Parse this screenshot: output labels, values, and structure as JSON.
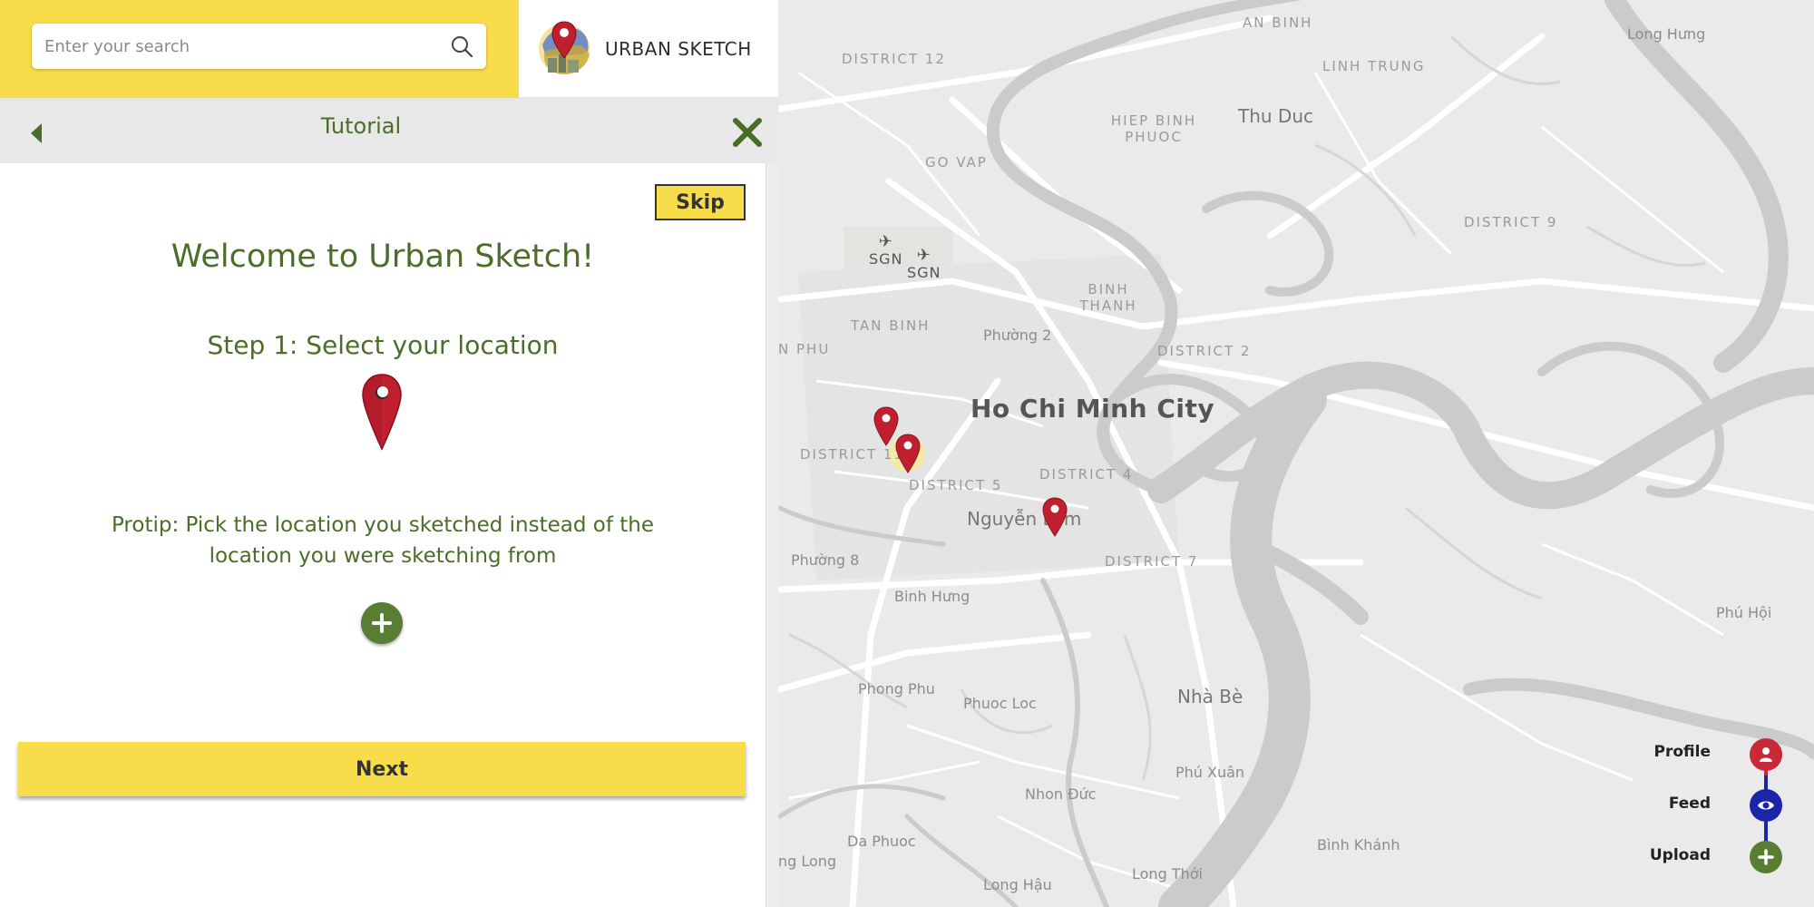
{
  "search": {
    "placeholder": "Enter your search"
  },
  "brand": {
    "name": "URBAN SKETCH"
  },
  "tutorial": {
    "title": "Tutorial",
    "skip_label": "Skip",
    "welcome": "Welcome to Urban Sketch!",
    "step": "Step 1: Select your location",
    "protip": "Protip: Pick the location you sketched instead of the location you were sketching from",
    "next_label": "Next"
  },
  "map": {
    "city": "Ho Chi Minh City",
    "labels": [
      "DISTRICT 12",
      "AN BINH",
      "LINH TRUNG",
      "Long Hưng",
      "HIEP BINH PHUOC",
      "Thu Duc",
      "GO VAP",
      "DISTRICT 9",
      "SGN",
      "BINH THANH",
      "TAN BINH",
      "Phường 2",
      "DISTRICT 2",
      "N PHU",
      "DISTRICT 11",
      "DISTRICT 5",
      "DISTRICT 4",
      "Nguyễn Lâm",
      "Phường 8",
      "DISTRICT 7",
      "Binh Hưng",
      "Phú Hội",
      "Phong Phu",
      "Phuoc Loc",
      "Nhà Bè",
      "Phú Xuân",
      "Nhon Đức",
      "Da Phuoc",
      "ng Long",
      "Bình Khánh",
      "Long Thới",
      "Long Hậu"
    ]
  },
  "nav": {
    "profile": "Profile",
    "feed": "Feed",
    "upload": "Upload"
  },
  "colors": {
    "accent_yellow": "#f9dc4a",
    "brand_green": "#4a6e28",
    "pin_red": "#c0202e",
    "profile": "#c82838",
    "feed": "#1b25a8",
    "upload": "#587e34"
  },
  "icons": [
    "search-icon",
    "map-pin-icon",
    "back-arrow-icon",
    "close-icon",
    "plus-icon",
    "person-icon",
    "eye-icon",
    "airplane-icon"
  ]
}
